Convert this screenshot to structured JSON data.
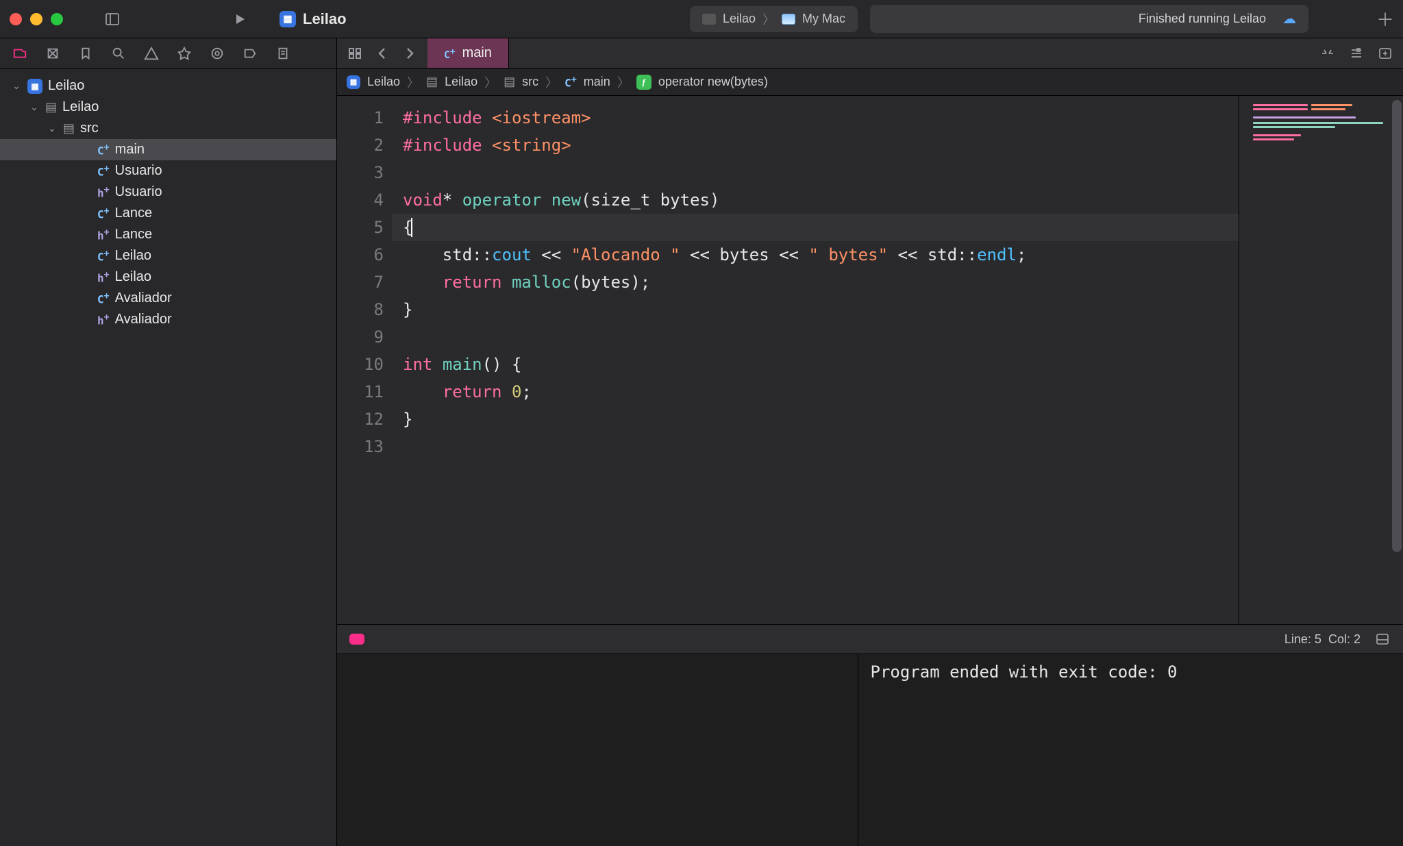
{
  "titlebar": {
    "scheme_name": "Leilao",
    "run_destination_project": "Leilao",
    "run_destination_device": "My Mac",
    "activity_status": "Finished running Leilao"
  },
  "sidebar": {
    "root_name": "Leilao",
    "items": [
      {
        "depth": 0,
        "kind": "app",
        "label": "Leilao",
        "expanded": true
      },
      {
        "depth": 1,
        "kind": "folder",
        "label": "Leilao",
        "expanded": true
      },
      {
        "depth": 2,
        "kind": "folder",
        "label": "src",
        "expanded": true
      },
      {
        "depth": 3,
        "kind": "cpp",
        "label": "main",
        "selected": true
      },
      {
        "depth": 3,
        "kind": "cpp",
        "label": "Usuario"
      },
      {
        "depth": 3,
        "kind": "h",
        "label": "Usuario"
      },
      {
        "depth": 3,
        "kind": "cpp",
        "label": "Lance"
      },
      {
        "depth": 3,
        "kind": "h",
        "label": "Lance"
      },
      {
        "depth": 3,
        "kind": "cpp",
        "label": "Leilao"
      },
      {
        "depth": 3,
        "kind": "h",
        "label": "Leilao"
      },
      {
        "depth": 3,
        "kind": "cpp",
        "label": "Avaliador"
      },
      {
        "depth": 3,
        "kind": "h",
        "label": "Avaliador"
      }
    ]
  },
  "tab": {
    "label": "main"
  },
  "jumpbar": {
    "segments": [
      {
        "kind": "app",
        "label": "Leilao"
      },
      {
        "kind": "folder",
        "label": "Leilao"
      },
      {
        "kind": "folder",
        "label": "src"
      },
      {
        "kind": "cpp",
        "label": "main"
      },
      {
        "kind": "method",
        "label": "operator new(bytes)"
      }
    ]
  },
  "code": {
    "lines": [
      {
        "n": 1,
        "tokens": [
          [
            "k-pre",
            "#include "
          ],
          [
            "k-inc",
            "<iostream>"
          ]
        ]
      },
      {
        "n": 2,
        "tokens": [
          [
            "k-pre",
            "#include "
          ],
          [
            "k-inc",
            "<string>"
          ]
        ]
      },
      {
        "n": 3,
        "tokens": []
      },
      {
        "n": 4,
        "tokens": [
          [
            "k-type",
            "void"
          ],
          [
            "",
            "* "
          ],
          [
            "k-func",
            "operator"
          ],
          [
            "",
            " "
          ],
          [
            "k-func",
            "new"
          ],
          [
            "",
            "(size_t bytes)"
          ]
        ]
      },
      {
        "n": 5,
        "hl": true,
        "tokens": [
          [
            "",
            "{"
          ]
        ]
      },
      {
        "n": 6,
        "tokens": [
          [
            "",
            "    std::"
          ],
          [
            "k-id",
            "cout"
          ],
          [
            "",
            " << "
          ],
          [
            "k-str",
            "\"Alocando \""
          ],
          [
            "",
            " << bytes << "
          ],
          [
            "k-str",
            "\" bytes\""
          ],
          [
            "",
            " << std::"
          ],
          [
            "k-id",
            "endl"
          ],
          [
            "",
            ";"
          ]
        ]
      },
      {
        "n": 7,
        "tokens": [
          [
            "",
            "    "
          ],
          [
            "k-type",
            "return"
          ],
          [
            "",
            " "
          ],
          [
            "k-func",
            "malloc"
          ],
          [
            "",
            "(bytes);"
          ]
        ]
      },
      {
        "n": 8,
        "tokens": [
          [
            "",
            "}"
          ]
        ]
      },
      {
        "n": 9,
        "tokens": []
      },
      {
        "n": 10,
        "tokens": [
          [
            "k-type",
            "int"
          ],
          [
            "",
            " "
          ],
          [
            "k-func",
            "main"
          ],
          [
            "",
            "() {"
          ]
        ]
      },
      {
        "n": 11,
        "tokens": [
          [
            "",
            "    "
          ],
          [
            "k-type",
            "return"
          ],
          [
            "",
            " "
          ],
          [
            "k-num",
            "0"
          ],
          [
            "",
            ";"
          ]
        ]
      },
      {
        "n": 12,
        "tokens": [
          [
            "",
            "}"
          ]
        ]
      },
      {
        "n": 13,
        "tokens": []
      }
    ]
  },
  "debugbar": {
    "line": "5",
    "col": "2",
    "linecol_label_line": "Line:",
    "linecol_label_col": "Col:"
  },
  "console": {
    "output": "Program ended with exit code: 0"
  }
}
